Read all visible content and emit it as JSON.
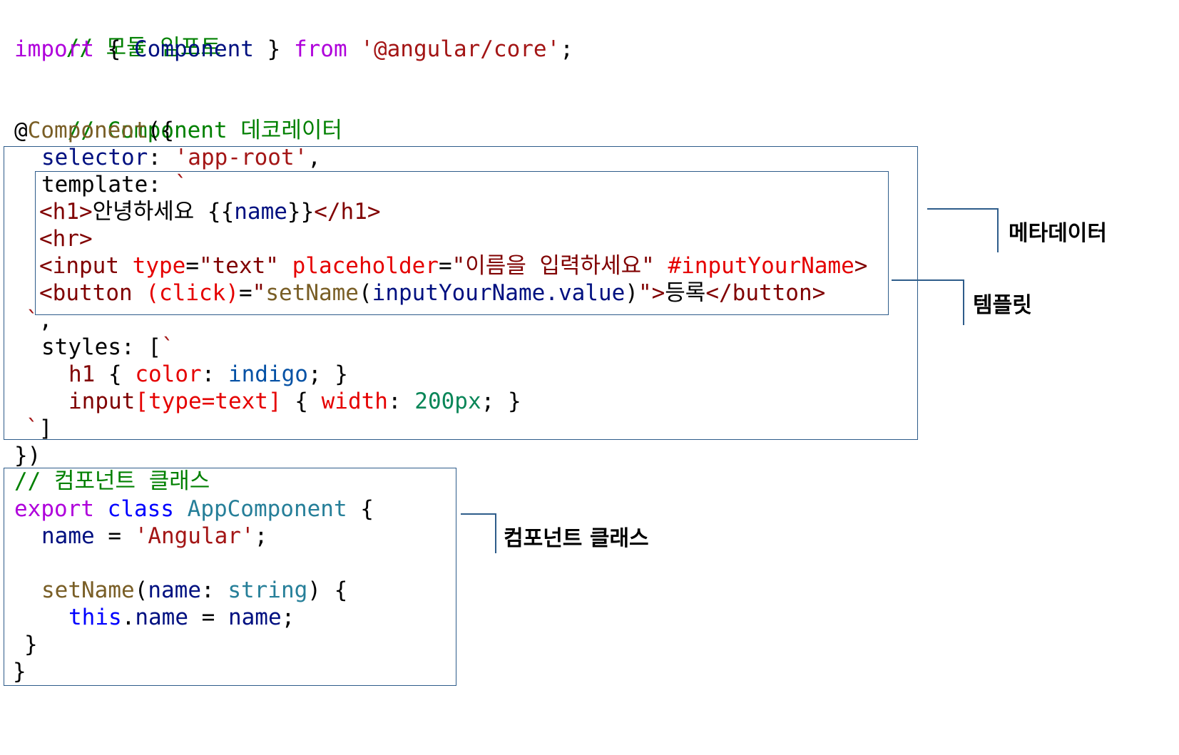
{
  "code": {
    "l1": {
      "comment": "// 모듈 임포트"
    },
    "l2": {
      "import_kw": "import",
      "open": " { ",
      "component": "Component",
      "close": " } ",
      "from_kw": "from",
      "space": " ",
      "module": "'@angular/core'",
      "semi": ";"
    },
    "l4": {
      "comment": "// Component 데코레이터"
    },
    "l5": {
      "at": "@",
      "decorator": "Component",
      "open": "({"
    },
    "l6": {
      "key": "selector",
      "colon": ": ",
      "value": "'app-root'",
      "comma": ","
    },
    "l7": {
      "key": "template",
      "colon": ": ",
      "tick": "`"
    },
    "l8": {
      "open_tag": "<h1>",
      "text": "안녕하세요 ",
      "interp_open": "{{",
      "var": "name",
      "interp_close": "}}",
      "close_tag": "</h1>"
    },
    "l9": {
      "tag": "<hr>"
    },
    "l10": {
      "tag_open": "<input",
      "sp1": " ",
      "attr1": "type",
      "eq1": "=",
      "val1": "\"text\"",
      "sp2": " ",
      "attr2": "placeholder",
      "eq2": "=",
      "val2": "\"이름을 입력하세요\"",
      "sp3": " ",
      "ref": "#inputYourName",
      "tag_end": ">"
    },
    "l11": {
      "tag_open": "<button",
      "sp": " ",
      "event": "(click)",
      "eq": "=",
      "q1": "\"",
      "handler": "setName",
      "paren_open": "(",
      "arg": "inputYourName.value",
      "paren_close": ")",
      "q2": "\"",
      "gt": ">",
      "label": "등록",
      "close_tag": "</button>"
    },
    "l12": {
      "tick": "`",
      "comma": ","
    },
    "l13": {
      "key": "styles",
      "colon": ": ",
      "open": "[",
      "tick": "`"
    },
    "l14": {
      "selector": "h1",
      "open": " { ",
      "prop": "color",
      "colon": ": ",
      "value": "indigo",
      "close": "; }"
    },
    "l15": {
      "selector": "input",
      "attr_sel": "[type=text]",
      "open": " { ",
      "prop": "width",
      "colon": ": ",
      "value": "200px",
      "close": "; }"
    },
    "l16": {
      "tick": "`",
      "close": "]"
    },
    "l17": {
      "close": "})"
    },
    "l18": {
      "comment": "// 컴포넌트 클래스"
    },
    "l19": {
      "export_kw": "export",
      "sp1": " ",
      "class_kw": "class",
      "sp2": " ",
      "class_name": "AppComponent",
      "open": " {"
    },
    "l20": {
      "prop": "name",
      "eq": " = ",
      "value": "'Angular'",
      "semi": ";"
    },
    "l22": {
      "method": "setName",
      "open": "(",
      "param": "name",
      "colon": ": ",
      "type": "string",
      "close": ") {"
    },
    "l23": {
      "this_kw": "this",
      "dot": ".",
      "prop": "name",
      "eq": " = ",
      "value": "name",
      "semi": ";"
    },
    "l24": {
      "close": "}"
    },
    "l25": {
      "close": "}"
    }
  },
  "annotations": {
    "metadata": "메타데이터",
    "template": "템플릿",
    "component_class": "컴포넌트 클래스"
  },
  "colors": {
    "comment": "#008000",
    "keyword": "#af00db",
    "string": "#a31515",
    "tag": "#800000",
    "attribute": "#e50000",
    "box_border": "#2e5c8a"
  }
}
